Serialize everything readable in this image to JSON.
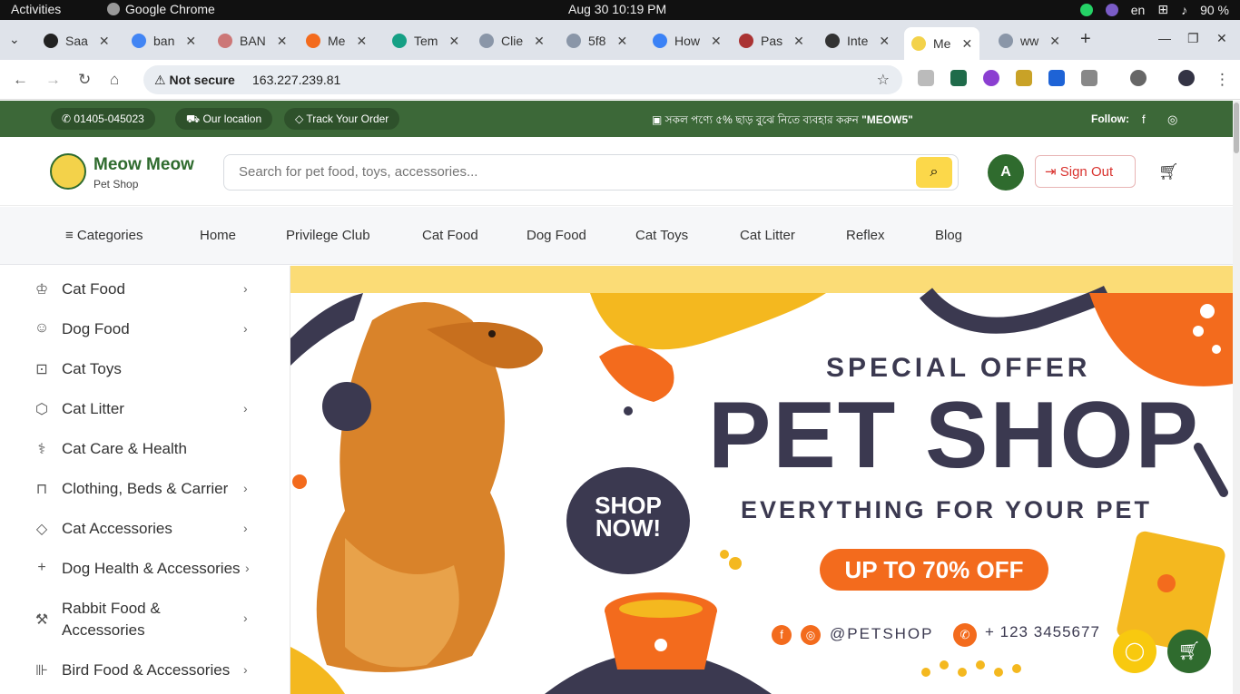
{
  "os": {
    "activities": "Activities",
    "app_name": "Google Chrome",
    "clock": "Aug 30  10:19 PM",
    "lang": "en",
    "battery": "90 %"
  },
  "tabs": [
    {
      "label": "Saa"
    },
    {
      "label": "ban"
    },
    {
      "label": "BAN"
    },
    {
      "label": "Me"
    },
    {
      "label": "Tem"
    },
    {
      "label": "Clie"
    },
    {
      "label": "5f8"
    },
    {
      "label": "How"
    },
    {
      "label": "Pas"
    },
    {
      "label": "Inte"
    },
    {
      "label": "Me"
    },
    {
      "label": "ww"
    }
  ],
  "address": {
    "security": "Not secure",
    "url": "163.227.239.81"
  },
  "topbar": {
    "phone": "01405-045023",
    "location": "Our location",
    "track": "Track Your Order",
    "promo_text": "সকল পণ্যে ৫% ছাড় বুঝে নিতে ব্যবহার করুন",
    "promo_code": "\"MEOW5\"",
    "follow": "Follow:"
  },
  "header": {
    "brand": "Meow Meow",
    "brand_sub": "Pet Shop",
    "search_placeholder": "Search for pet food, toys, accessories...",
    "avatar_initial": "A",
    "signout": "Sign Out"
  },
  "nav": [
    {
      "label": "Categories"
    },
    {
      "label": "Home"
    },
    {
      "label": "Privilege Club"
    },
    {
      "label": "Cat Food"
    },
    {
      "label": "Dog Food"
    },
    {
      "label": "Cat Toys"
    },
    {
      "label": "Cat Litter"
    },
    {
      "label": "Reflex"
    },
    {
      "label": "Blog"
    }
  ],
  "sidebar": [
    {
      "label": "Cat Food",
      "icon": "crown-icon"
    },
    {
      "label": "Dog Food",
      "icon": "dog-icon"
    },
    {
      "label": "Cat Toys",
      "icon": "gamepad-icon"
    },
    {
      "label": "Cat Litter",
      "icon": "box-icon"
    },
    {
      "label": "Cat Care & Health",
      "icon": "stethoscope-icon"
    },
    {
      "label": "Clothing, Beds & Carrier",
      "icon": "shirt-icon"
    },
    {
      "label": "Cat Accessories",
      "icon": "diamond-icon"
    },
    {
      "label": "Dog Health & Accessories",
      "icon": "plus-icon"
    },
    {
      "label": "Rabbit Food & Accessories",
      "icon": "wrench-icon"
    },
    {
      "label": "Bird Food & Accessories",
      "icon": "bottle-icon"
    }
  ],
  "banner": {
    "special": "SPECIAL OFFER",
    "title": "PET SHOP",
    "tagline": "EVERYTHING FOR YOUR PET",
    "offer": "UP TO 70% OFF",
    "handle": "@PETSHOP",
    "phone": "+ 123 3455677",
    "shop_now_1": "SHOP",
    "shop_now_2": "NOW!"
  },
  "colors": {
    "brand_green": "#3c6838",
    "accent_yellow": "#fcd84a",
    "signout_red": "#d9322e",
    "banner_orange": "#f36b1d",
    "banner_navy": "#3b3950"
  }
}
